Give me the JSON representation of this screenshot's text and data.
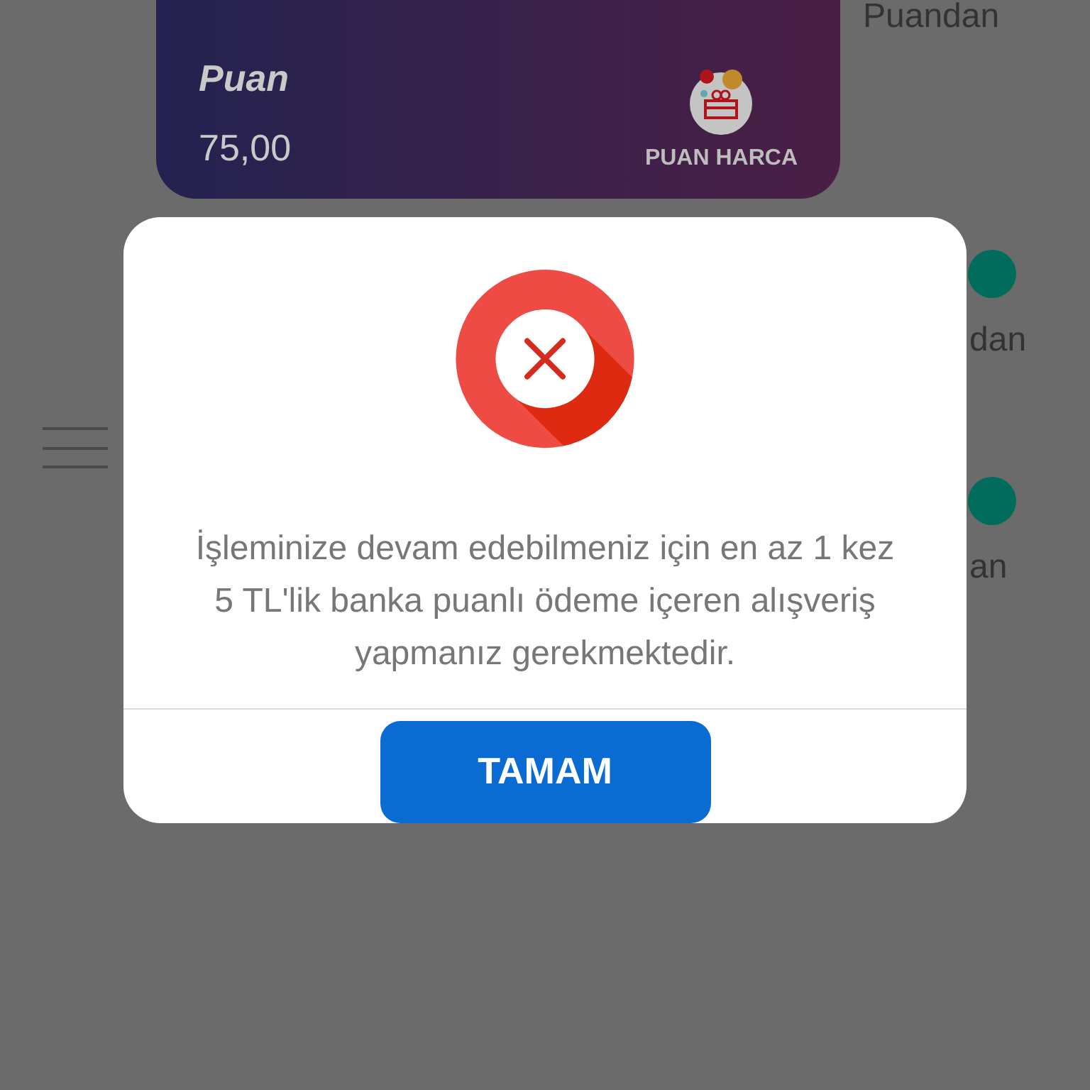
{
  "card": {
    "title": "Puan",
    "amount": "75,00",
    "action": "PUAN HARCA"
  },
  "side_labels": [
    {
      "text": "Puandan",
      "kind": "plain"
    },
    {
      "text": "dan",
      "kind": "dotted"
    },
    {
      "text": "an",
      "kind": "dotted"
    }
  ],
  "dialog": {
    "message": "İşleminize devam edebilmeniz için en az 1 kez 5 TL'lik banka puanlı ödeme içeren alışveriş yapmanız gerekmektedir.",
    "button": "TAMAM"
  }
}
